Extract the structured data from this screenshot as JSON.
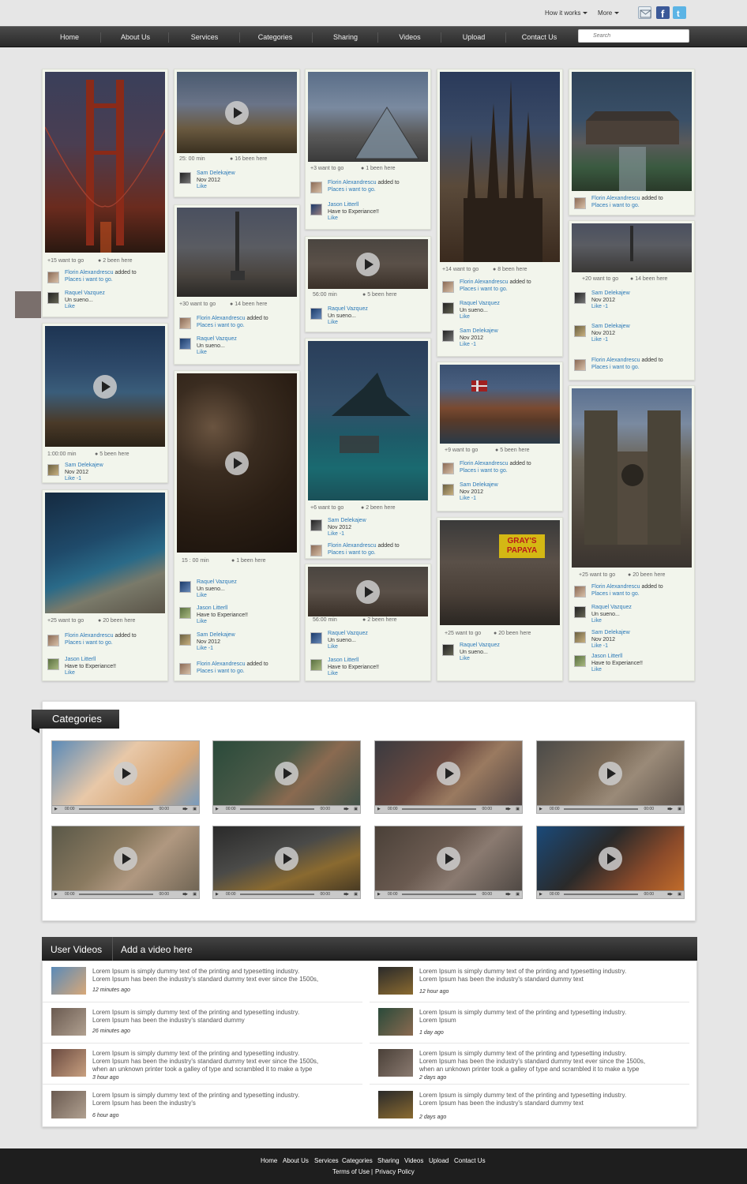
{
  "topbar": {
    "how_it_works": "How it works",
    "more": "More"
  },
  "nav": {
    "items": [
      "Home",
      "About Us",
      "Services",
      "Categories",
      "Sharing",
      "Videos",
      "Upload",
      "Contact Us"
    ],
    "search_placeholder": "Search"
  },
  "cards": {
    "c1": {
      "stat1": "+15 want to go",
      "stat2": "2 been here",
      "a1": {
        "name": "Florin Alexandrescu",
        "verb": "added to",
        "text": "Places i want to go."
      },
      "a2": {
        "name": "Raquel Vazquez",
        "text": "Un sueno...",
        "like": "Like"
      }
    },
    "c2": {
      "stat1": "25: 00 min",
      "stat2": "16 been here",
      "a1": {
        "name": "Sam Delekajew",
        "text": "Nov 2012",
        "like": "Like"
      }
    },
    "c3": {
      "stat1": "+3 want to go",
      "stat2": "1 been here",
      "a1": {
        "name": "Florin Alexandrescu",
        "verb": "added to",
        "text": "Places i want to go."
      },
      "a2": {
        "name": "Jason Litterll",
        "text": "Have to Experiance!!",
        "like": "Like"
      }
    },
    "c4": {
      "stat1": "+14 want to go",
      "stat2": "8 been here",
      "a1": {
        "name": "Florin Alexandrescu",
        "verb": "added to",
        "text": "Places i want to go."
      },
      "a2": {
        "name": "Raquel Vazquez",
        "text": "Un sueno...",
        "like": "Like"
      },
      "a3": {
        "name": "Sam Delekajew",
        "text": "Nov 2012",
        "like": "Like  -1"
      }
    },
    "c5": {
      "a1": {
        "name": "Florin Alexandrescu",
        "verb": "added to",
        "text": "Places i want to go."
      }
    },
    "c6": {
      "stat1": "+30 want to go",
      "stat2": "14 been here",
      "a1": {
        "name": "Florin Alexandrescu",
        "verb": "added to",
        "text": "Places i want to go."
      },
      "a2": {
        "name": "Raquel Vazquez",
        "text": "Un sueno...",
        "like": "Like"
      }
    },
    "c7": {
      "stat1": "56:00 min",
      "stat2": "5 been here",
      "a1": {
        "name": "Raquel Vazquez",
        "text": "Un sueno...",
        "like": "Like"
      }
    },
    "c8": {
      "stat1": "+20 want to go",
      "stat2": "14 been here",
      "a1": {
        "name": "Sam Delekajew",
        "text": "Nov 2012",
        "like": "Like  -1"
      },
      "a2": {
        "name": "Sam Delekajew",
        "text": "Nov 2012",
        "like": "Like  -1"
      },
      "a3": {
        "name": "Florin Alexandrescu",
        "verb": "added to",
        "text": "Places i want to go."
      }
    },
    "c9": {
      "stat1": "1:00:00 min",
      "stat2": "5 been here",
      "a1": {
        "name": "Sam Delekajew",
        "text": "Nov 2012",
        "like": "Like  -1"
      }
    },
    "c10": {
      "stat1": "15 : 00 min",
      "stat2": "1 been here",
      "a1": {
        "name": "Raquel Vazquez",
        "text": "Un sueno...",
        "like": "Like"
      },
      "a2": {
        "name": "Jason Litterll",
        "text": "Have to Experiance!!",
        "like": "Like"
      },
      "a3": {
        "name": "Sam Delekajew",
        "text": "Nov 2012",
        "like": "Like  -1"
      },
      "a4": {
        "name": "Florin Alexandrescu",
        "verb": "added to",
        "text": "Places i want to go."
      }
    },
    "c11": {
      "stat1": "+6 want to go",
      "stat2": "2 been here",
      "a1": {
        "name": "Sam Delekajew",
        "text": "Nov 2012",
        "like": "Like  -1"
      },
      "a2": {
        "name": "Florin Alexandrescu",
        "verb": "added to",
        "text": "Places i want to go."
      }
    },
    "c12": {
      "stat1": "+9 want to go",
      "stat2": "5 been here",
      "a1": {
        "name": "Florin Alexandrescu",
        "verb": "added to",
        "text": "Places i want to go."
      },
      "a2": {
        "name": "Sam Delekajew",
        "text": "Nov 2012",
        "like": "Like  -1"
      }
    },
    "c13": {
      "stat1": "+25 want to go",
      "stat2": "20 been here",
      "a1": {
        "name": "Florin Alexandrescu",
        "verb": "added to",
        "text": "Places i want to go."
      },
      "a2": {
        "name": "Raquel Vazquez",
        "text": "Un sueno...",
        "like": "Like"
      },
      "a3": {
        "name": "Sam Delekajew",
        "text": "Nov 2012",
        "like": "Like  -1"
      },
      "a4": {
        "name": "Jason Litterll",
        "text": "Have to Experiance!!",
        "like": "Like"
      }
    },
    "c14": {
      "stat1": "+25 want to go",
      "stat2": "20 been here",
      "a1": {
        "name": "Florin Alexandrescu",
        "verb": "added to",
        "text": "Places i want to go."
      },
      "a2": {
        "name": "Jason Litterll",
        "text": "Have to Experiance!!",
        "like": "Like"
      }
    },
    "c15": {
      "stat1": "56:00 min",
      "stat2": "2 been here",
      "a1": {
        "name": "Raquel Vazquez",
        "text": "Un sueno...",
        "like": "Like"
      },
      "a2": {
        "name": "Jason Litterll",
        "text": "Have to Experiance!!",
        "like": "Like"
      }
    },
    "c16": {
      "stat1": "+25 want to go",
      "stat2": "20 been here",
      "a1": {
        "name": "Raquel Vazquez",
        "text": "Un sueno...",
        "like": "Like"
      }
    }
  },
  "image_text": {
    "papaya": "GRAY'S PAPAYA"
  },
  "categories": {
    "title": "Categories",
    "player_time": "00:00"
  },
  "user_videos": {
    "tab1": "User Videos",
    "tab2": "Add a video here",
    "items": [
      {
        "line1": "Lorem Ipsum is simply dummy text of the printing and typesetting industry.",
        "line2": "Lorem Ipsum has been the industry's standard dummy text ever since the 1500s,",
        "line3": "",
        "time": "12 minutes ago"
      },
      {
        "line1": "Lorem Ipsum is simply dummy text of the printing and typesetting industry.",
        "line2": "Lorem Ipsum has been the industry's standard dummy text",
        "line3": "",
        "time": "12 hour ago"
      },
      {
        "line1": "Lorem Ipsum is simply dummy text of the printing and typesetting industry.",
        "line2": "Lorem Ipsum has been the industry's standard dummy",
        "line3": "",
        "time": "26 minutes ago"
      },
      {
        "line1": "Lorem Ipsum is simply dummy text of the printing and typesetting industry.",
        "line2": "Lorem Ipsum",
        "line3": "",
        "time": "1 day ago"
      },
      {
        "line1": "Lorem Ipsum is simply dummy text of the printing and typesetting industry.",
        "line2": "Lorem Ipsum has been the industry's standard dummy text ever since the 1500s,",
        "line3": "when an unknown printer took a galley of type and scrambled it to make a type",
        "time": "3 hour ago"
      },
      {
        "line1": "Lorem Ipsum is simply dummy text of the printing and typesetting industry.",
        "line2": "Lorem Ipsum has been the industry's standard dummy text ever since the 1500s,",
        "line3": "when an unknown printer took a galley of type and scrambled it to make a type",
        "time": "2 days ago"
      },
      {
        "line1": "Lorem Ipsum is simply dummy text of the printing and typesetting industry.",
        "line2": "Lorem Ipsum has been the industry's",
        "line3": "",
        "time": "6 hour ago"
      },
      {
        "line1": "Lorem Ipsum is simply dummy text of the printing and typesetting industry.",
        "line2": "Lorem Ipsum has been the industry's standard dummy text",
        "line3": "",
        "time": "2 days ago"
      }
    ]
  },
  "footer": {
    "links": [
      "Home",
      "About Us",
      "Services",
      "Categories",
      "Sharing",
      "Videos",
      "Upload",
      "Contact Us"
    ],
    "terms": "Terms of Use",
    "sep": "|",
    "privacy": "Privacy Policy"
  },
  "colors": {
    "link": "#2b79b8",
    "nav_bg": "#2a2a2a",
    "card_bg": "#f2f5ec",
    "page_bg": "#e6e6e6"
  },
  "icons": [
    "mail-icon",
    "facebook-icon",
    "twitter-icon",
    "play-icon",
    "pin-icon"
  ]
}
